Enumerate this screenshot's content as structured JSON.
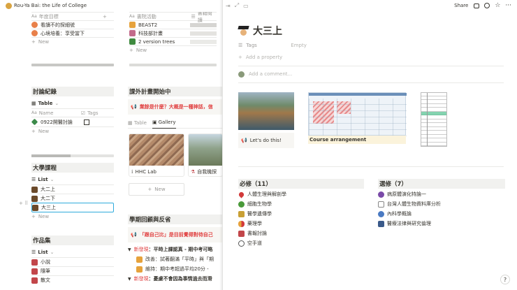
{
  "topbar": {
    "page_title": "Rou-Ya Bai: the Life of College",
    "share": "Share"
  },
  "col1": {
    "table_top": {
      "col_name": "年度目標",
      "col_plus": "+",
      "rows": [
        "看讀不的探細號",
        "心境培養：享受當下"
      ],
      "new": "New"
    },
    "discussion": {
      "title": "討論紀錄",
      "view": "Table",
      "col_name": "Name",
      "col_tags": "Tags",
      "rows": [
        "0922開醫討論"
      ],
      "new": "New"
    },
    "courses": {
      "title": "大學課程",
      "view": "List",
      "items": [
        "大二上",
        "大二下",
        "大三上"
      ],
      "new": "New"
    },
    "works": {
      "title": "作品集",
      "view": "List",
      "items": [
        "小說",
        "隨筆",
        "散文"
      ]
    }
  },
  "col2": {
    "table_top": {
      "col_name": "書院活動",
      "col_extra": "書籍閱讀",
      "rows": [
        "BEAST2",
        "科技部計畫",
        "2 version trees"
      ],
      "new": "New"
    },
    "extracurricular": {
      "title": "課外計畫開始中",
      "callout": "業餘是什麼？大概是一種神話，信",
      "tabs": [
        "Table",
        "Gallery"
      ],
      "cards": [
        "HHC Lab",
        "自我機探"
      ],
      "new": "New"
    },
    "review": {
      "title": "學期回顧與反省",
      "callout": "「跟自己比」是目前覺得對待自己",
      "toggles": [
        {
          "tag": "新發現",
          "text": "：平時上課認真 - 期中考可略"
        },
        {
          "tag": "改善",
          "text": "：試著翻滿「平時」與「期"
        },
        {
          "tag": "維持",
          "text": "：期中考超過平均20分 -"
        },
        {
          "tag": "新發現",
          "text": "：憂慮不會因為事情過去而滑"
        }
      ]
    }
  },
  "page": {
    "title": "大三上",
    "prop_tags": "Tags",
    "prop_empty": "Empty",
    "add_property": "Add a property",
    "add_comment": "Add a comment...",
    "gallery": {
      "callout": "Let's do this!",
      "course_label": "Course arrangement"
    },
    "required": {
      "title": "必修（11）",
      "items": [
        "人體生理與解剖學",
        "細胞生物學",
        "醫學遺傳學",
        "藥理學",
        "書報討論",
        "空手道"
      ]
    },
    "elective": {
      "title": "選修（7）",
      "items": [
        "病原體演化特論一",
        "台灣人體生物資料庫分析",
        "內科學概論",
        "醫療法律與研究倫理"
      ]
    }
  },
  "colors": {
    "red": "#e03e3e",
    "bg_header": "#f1f1ef",
    "text": "#37352f",
    "muted": "#9b9a97"
  }
}
